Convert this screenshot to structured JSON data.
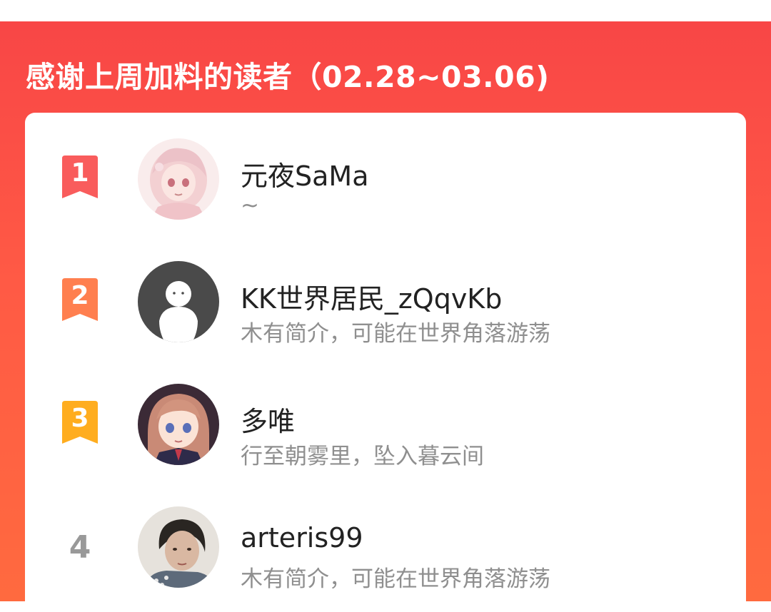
{
  "panel": {
    "title": "感谢上周加料的读者（02.28~03.06)",
    "colors": {
      "background_top": "#f84646",
      "background_bottom": "#ff6a3f",
      "rank1": "#f95c5c",
      "rank2": "#ff7f4f",
      "rank3": "#ffad1f",
      "rank_plain": "#999999"
    }
  },
  "readers": [
    {
      "rank": "1",
      "name": "元夜SaMa",
      "bio": "~",
      "avatar": "anime-girl-pink-hair-avatar"
    },
    {
      "rank": "2",
      "name": "KK世界居民_zQqvKb",
      "bio": "木有简介，可能在世界角落游荡",
      "avatar": "default-user-avatar"
    },
    {
      "rank": "3",
      "name": "多唯",
      "bio": "行至朝雾里，坠入暮云间",
      "avatar": "anime-girl-brown-hair-avatar"
    },
    {
      "rank": "4",
      "name": "arteris99",
      "bio": "木有简介，可能在世界角落游荡",
      "avatar": "photo-portrait-avatar"
    }
  ]
}
